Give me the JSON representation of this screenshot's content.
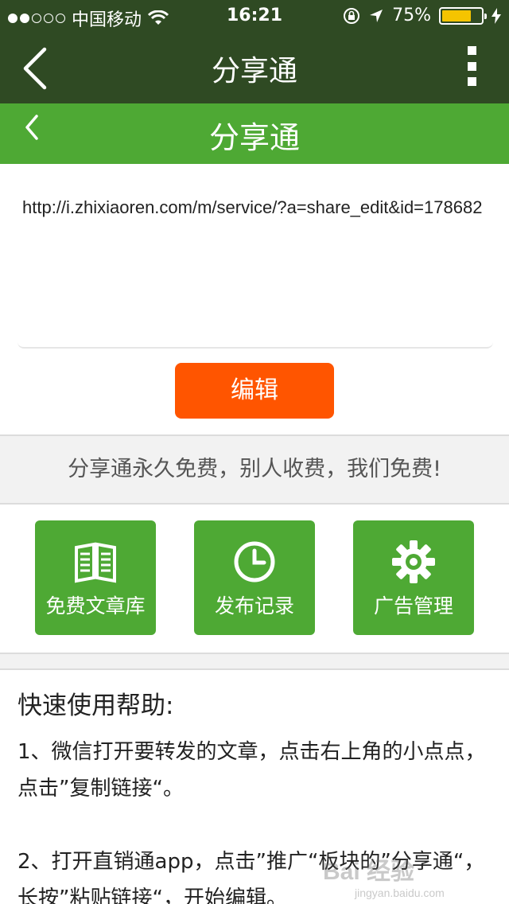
{
  "status_bar": {
    "carrier": "中国移动",
    "time": "16:21",
    "battery": "75%"
  },
  "app_bar": {
    "title": "分享通",
    "back_icon": "chevron-left-icon",
    "more_icon": "more-vertical-icon"
  },
  "sub_bar": {
    "title": "分享通"
  },
  "url_box": {
    "value": "http://i.zhixiaoren.com/m/service/?a=share_edit&id=178682"
  },
  "edit_button": {
    "label": "编辑",
    "color": "#ff5500"
  },
  "banner": {
    "text": "分享通永久免费，别人收费，我们免费!"
  },
  "tiles": [
    {
      "label": "免费文章库",
      "icon": "book-icon"
    },
    {
      "label": "发布记录",
      "icon": "clock-icon"
    },
    {
      "label": "广告管理",
      "icon": "gear-icon"
    }
  ],
  "help": {
    "title": "快速使用帮助:",
    "steps": [
      "1、微信打开要转发的文章，点击右上角的小点点，点击”复制链接“。",
      "2、打开直销通app，点击”推广“板块的”分享通“，长按”粘贴链接“，开始编辑。"
    ]
  },
  "watermark": {
    "brand": "Bai 经验",
    "url": "jingyan.baidu.com"
  },
  "colors": {
    "dark_green": "#2f4a23",
    "green": "#4ea934",
    "orange": "#ff5500"
  }
}
